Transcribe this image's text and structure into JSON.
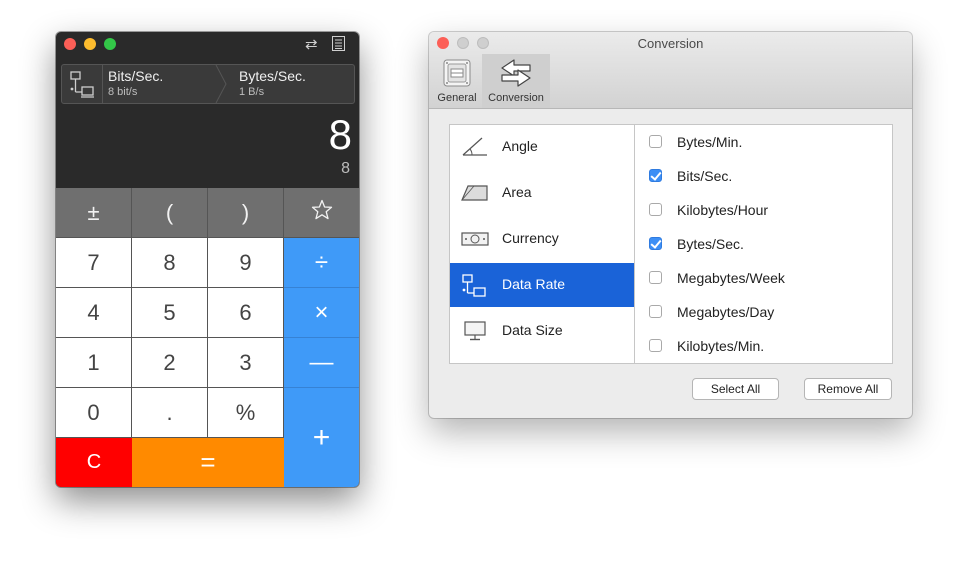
{
  "calculator": {
    "toolbar_icons": [
      "swap-icon",
      "history-icon"
    ],
    "conversion": {
      "from_unit": "Bits/Sec.",
      "from_value": "8 bit/s",
      "to_unit": "Bytes/Sec.",
      "to_value": "1 B/s"
    },
    "display": {
      "main": "8",
      "secondary": "8"
    },
    "keys": {
      "plus_minus": "±",
      "open_paren": "(",
      "close_paren": ")",
      "n7": "7",
      "n8": "8",
      "n9": "9",
      "divide": "÷",
      "n4": "4",
      "n5": "5",
      "n6": "6",
      "multiply": "×",
      "n1": "1",
      "n2": "2",
      "n3": "3",
      "minus": "—",
      "n0": "0",
      "decimal": ".",
      "percent": "%",
      "plus": "+",
      "clear": "C",
      "equals": "="
    },
    "colors": {
      "operator": "#3f9af8",
      "clear": "#ff0000",
      "equals": "#ff8a00",
      "function": "#6f6f6f"
    }
  },
  "preferences": {
    "title": "Conversion",
    "tabs": [
      {
        "label": "General",
        "icon": "general-icon"
      },
      {
        "label": "Conversion",
        "icon": "conversion-icon",
        "active": true
      }
    ],
    "categories": [
      {
        "label": "Angle",
        "icon": "angle-icon"
      },
      {
        "label": "Area",
        "icon": "area-icon"
      },
      {
        "label": "Currency",
        "icon": "currency-icon"
      },
      {
        "label": "Data Rate",
        "icon": "data-rate-icon",
        "selected": true
      },
      {
        "label": "Data Size",
        "icon": "data-size-icon"
      }
    ],
    "units": [
      {
        "label": "Bytes/Min.",
        "checked": false
      },
      {
        "label": "Bits/Sec.",
        "checked": true
      },
      {
        "label": "Kilobytes/Hour",
        "checked": false
      },
      {
        "label": "Bytes/Sec.",
        "checked": true
      },
      {
        "label": "Megabytes/Week",
        "checked": false
      },
      {
        "label": "Megabytes/Day",
        "checked": false
      },
      {
        "label": "Kilobytes/Min.",
        "checked": false
      }
    ],
    "buttons": {
      "select_all": "Select All",
      "remove_all": "Remove All"
    },
    "colors": {
      "selection": "#1a63d8",
      "checkbox_on": "#3d8ff5"
    }
  }
}
